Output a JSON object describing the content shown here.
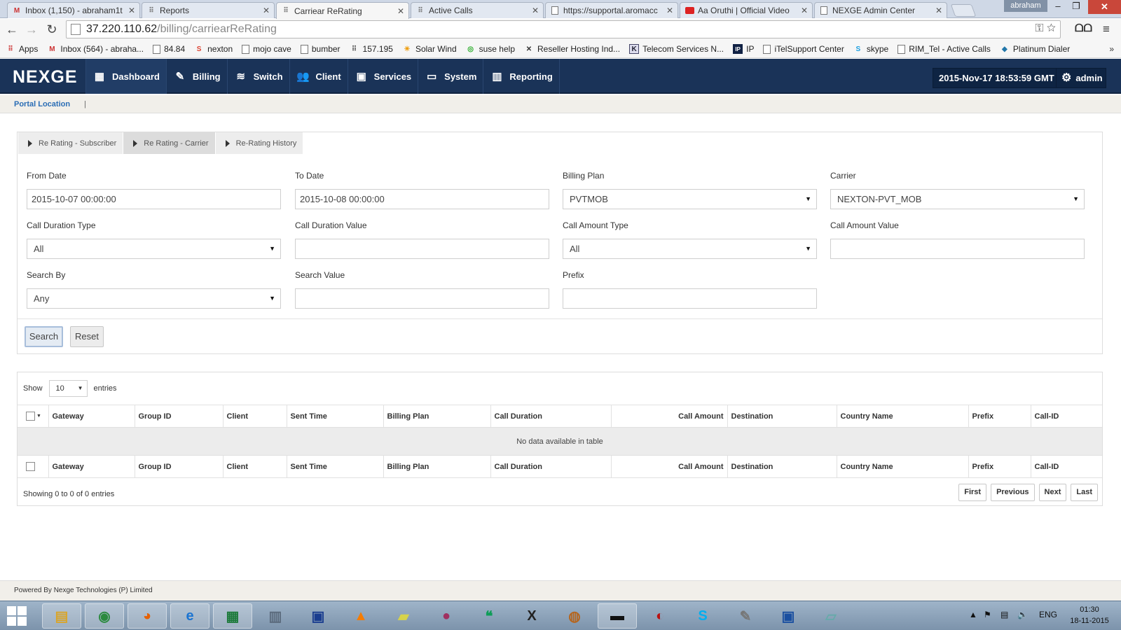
{
  "browser": {
    "tabs": [
      {
        "title": "Inbox (1,150) - abraham1t",
        "icon": "gmail-icon",
        "x": 0
      },
      {
        "title": "Reports",
        "icon": "grid-icon",
        "x": 0
      },
      {
        "title": "Carriear ReRating",
        "icon": "grid-icon",
        "x": 0,
        "active": true
      },
      {
        "title": "Active Calls",
        "icon": "grid-icon",
        "x": 0
      },
      {
        "title": "https://supportal.aromacc",
        "icon": "page-icon",
        "x": 0
      },
      {
        "title": "Aa Oruthi | Official Video",
        "icon": "youtube-icon",
        "x": 0
      },
      {
        "title": "NEXGE Admin Center",
        "icon": "page-icon",
        "x": 0
      }
    ],
    "user_chip": "abraham",
    "url_host": "37.220.110.62",
    "url_path": "/billing/carriearReRating",
    "bookmarks": [
      {
        "label": "Apps",
        "icon": "apps-icon"
      },
      {
        "label": "Inbox (564) - abraha...",
        "icon": "gmail-icon"
      },
      {
        "label": "84.84",
        "icon": "page-icon"
      },
      {
        "label": "nexton",
        "icon": "nexton-icon"
      },
      {
        "label": "mojo cave",
        "icon": "page-icon"
      },
      {
        "label": "bumber",
        "icon": "page-icon"
      },
      {
        "label": "157.195",
        "icon": "grid-icon"
      },
      {
        "label": "Solar Wind",
        "icon": "solarwind-icon"
      },
      {
        "label": "suse help",
        "icon": "suse-icon"
      },
      {
        "label": "Reseller Hosting Ind...",
        "icon": "reseller-icon"
      },
      {
        "label": "Telecom Services N...",
        "icon": "k-icon"
      },
      {
        "label": "IP",
        "icon": "ip-icon"
      },
      {
        "label": "iTelSupport Center",
        "icon": "page-icon"
      },
      {
        "label": "skype",
        "icon": "skype-icon"
      },
      {
        "label": "RIM_Tel - Active Calls",
        "icon": "page-icon"
      },
      {
        "label": "Platinum Dialer",
        "icon": "platinum-icon"
      }
    ],
    "bookmarks_more": "»"
  },
  "app": {
    "logo": "NEXGE",
    "nav": [
      {
        "label": "Dashboard",
        "icon": "dashboard-icon",
        "glyph": "▦"
      },
      {
        "label": "Billing",
        "icon": "billing-icon",
        "glyph": "✎"
      },
      {
        "label": "Switch",
        "icon": "switch-icon",
        "glyph": "≋"
      },
      {
        "label": "Client",
        "icon": "client-icon",
        "glyph": "👥"
      },
      {
        "label": "Services",
        "icon": "services-icon",
        "glyph": "▣"
      },
      {
        "label": "System",
        "icon": "system-icon",
        "glyph": "▭"
      },
      {
        "label": "Reporting",
        "icon": "reporting-icon",
        "glyph": "▥"
      }
    ],
    "datetime": "2015-Nov-17 18:53:59 GMT",
    "admin_label": "admin",
    "breadcrumb_link": "Portal Location",
    "breadcrumb_sep": "|"
  },
  "filters": {
    "subtabs": [
      "Re Rating - Subscriber",
      "Re Rating - Carrier",
      "Re-Rating History"
    ],
    "active_subtab": 1,
    "from_date_label": "From Date",
    "from_date_value": "2015-10-07 00:00:00",
    "to_date_label": "To Date",
    "to_date_value": "2015-10-08 00:00:00",
    "billing_plan_label": "Billing Plan",
    "billing_plan_value": "PVTMOB",
    "carrier_label": "Carrier",
    "carrier_value": "NEXTON-PVT_MOB",
    "call_duration_type_label": "Call Duration Type",
    "call_duration_type_value": "All",
    "call_duration_value_label": "Call Duration Value",
    "call_duration_value_value": "",
    "call_amount_type_label": "Call Amount Type",
    "call_amount_type_value": "All",
    "call_amount_value_label": "Call Amount Value",
    "call_amount_value_value": "",
    "search_by_label": "Search By",
    "search_by_value": "Any",
    "search_value_label": "Search Value",
    "search_value_value": "",
    "prefix_label": "Prefix",
    "prefix_value": "",
    "search_button": "Search",
    "reset_button": "Reset"
  },
  "table": {
    "show_label": "Show",
    "page_length": "10",
    "entries_label": "entries",
    "columns": [
      "Gateway",
      "Group ID",
      "Client",
      "Sent Time",
      "Billing Plan",
      "Call Duration",
      "Call Amount",
      "Destination",
      "Country Name",
      "Prefix",
      "Call-ID"
    ],
    "empty_message": "No data available in table",
    "info": "Showing 0 to 0 of 0 entries",
    "pager": [
      "First",
      "Previous",
      "Next",
      "Last"
    ]
  },
  "footer": {
    "text": "Powered By Nexge Technologies (P) Limited"
  },
  "taskbar": {
    "apps": [
      "explorer-icon",
      "chrome-icon",
      "firefox-icon",
      "ie-icon",
      "excel-icon",
      "calculator-icon",
      "network-icon",
      "vlc-icon",
      "sticky-notes-icon",
      "chat-icon",
      "hangouts-icon",
      "xmanager-icon",
      "filezilla-icon",
      "cmd-icon",
      "media-icon",
      "skype-icon",
      "paint-icon",
      "remote-icon",
      "files-icon"
    ],
    "lang": "ENG",
    "time": "01:30",
    "date": "18-11-2015"
  }
}
